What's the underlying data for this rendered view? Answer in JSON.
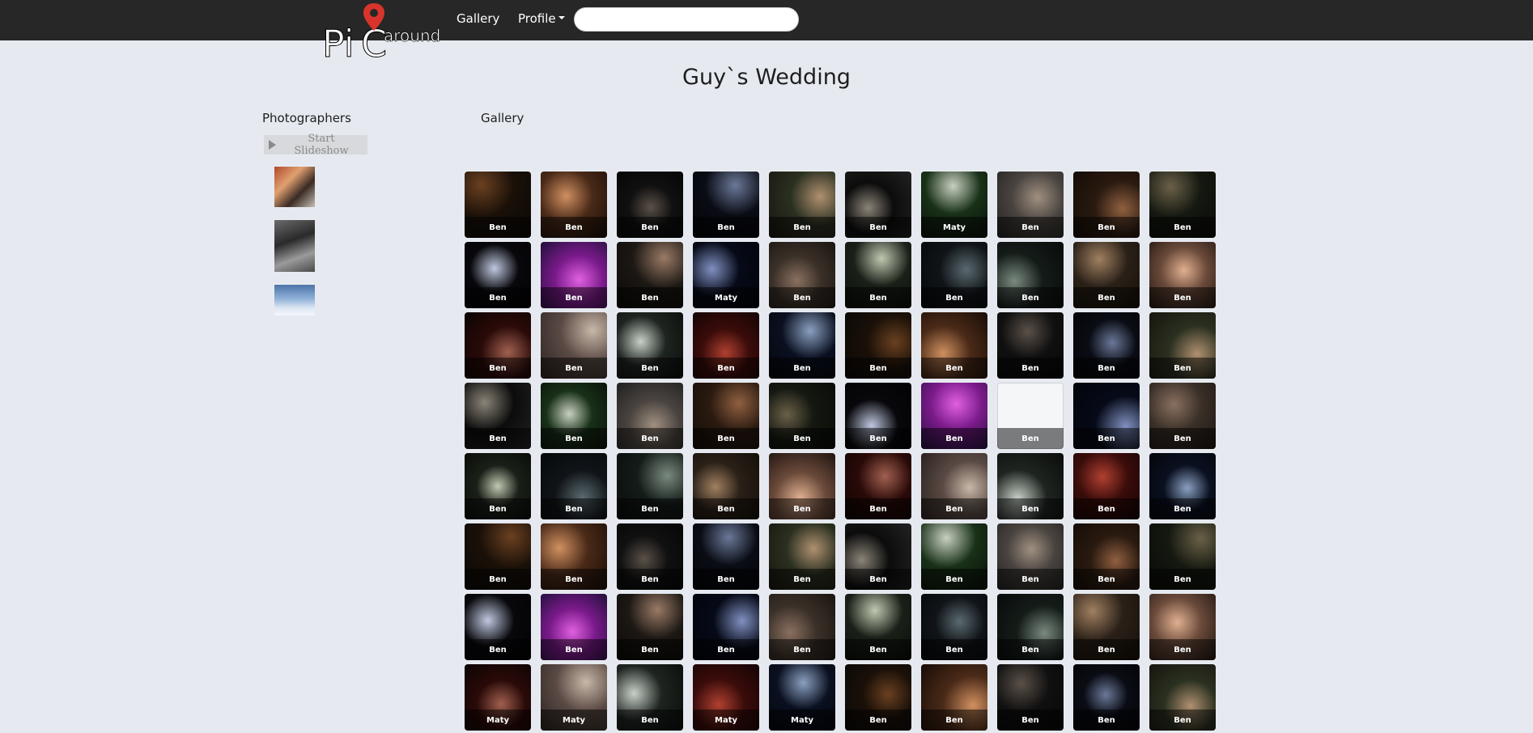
{
  "header": {
    "logo_text": "Pic around",
    "nav": [
      {
        "label": "Gallery"
      },
      {
        "label": "Profile"
      }
    ],
    "search": {
      "value": "",
      "placeholder": ""
    }
  },
  "page": {
    "title": "Guy`s Wedding"
  },
  "sidebar": {
    "title": "Photographers",
    "slideshow_label": "Start Slideshow"
  },
  "gallery": {
    "title": "Gallery",
    "photographers": [
      "Ben",
      "Ben",
      "Ben",
      "Ben",
      "Ben",
      "Ben",
      "Maty",
      "Ben",
      "Ben",
      "Ben",
      "Ben",
      "Ben",
      "Ben",
      "Maty",
      "Ben",
      "Ben",
      "Ben",
      "Ben",
      "Ben",
      "Ben",
      "Ben",
      "Ben",
      "Ben",
      "Ben",
      "Ben",
      "Ben",
      "Ben",
      "Ben",
      "Ben",
      "Ben",
      "Ben",
      "Ben",
      "Ben",
      "Ben",
      "Ben",
      "Ben",
      "Ben",
      "Ben",
      "Ben",
      "Ben",
      "Ben",
      "Ben",
      "Ben",
      "Ben",
      "Ben",
      "Ben",
      "Ben",
      "Ben",
      "Ben",
      "Ben",
      "Ben",
      "Ben",
      "Ben",
      "Ben",
      "Ben",
      "Ben",
      "Ben",
      "Ben",
      "Ben",
      "Ben",
      "Ben",
      "Ben",
      "Ben",
      "Ben",
      "Ben",
      "Ben",
      "Ben",
      "Ben",
      "Ben",
      "Ben",
      "Maty",
      "Maty",
      "Ben",
      "Maty",
      "Maty",
      "Ben",
      "Ben",
      "Ben",
      "Ben",
      "Ben"
    ]
  },
  "colors": {
    "topbar": "#272727",
    "page_bg": "#e6eaf0",
    "logo_pin": "#d9342b"
  }
}
